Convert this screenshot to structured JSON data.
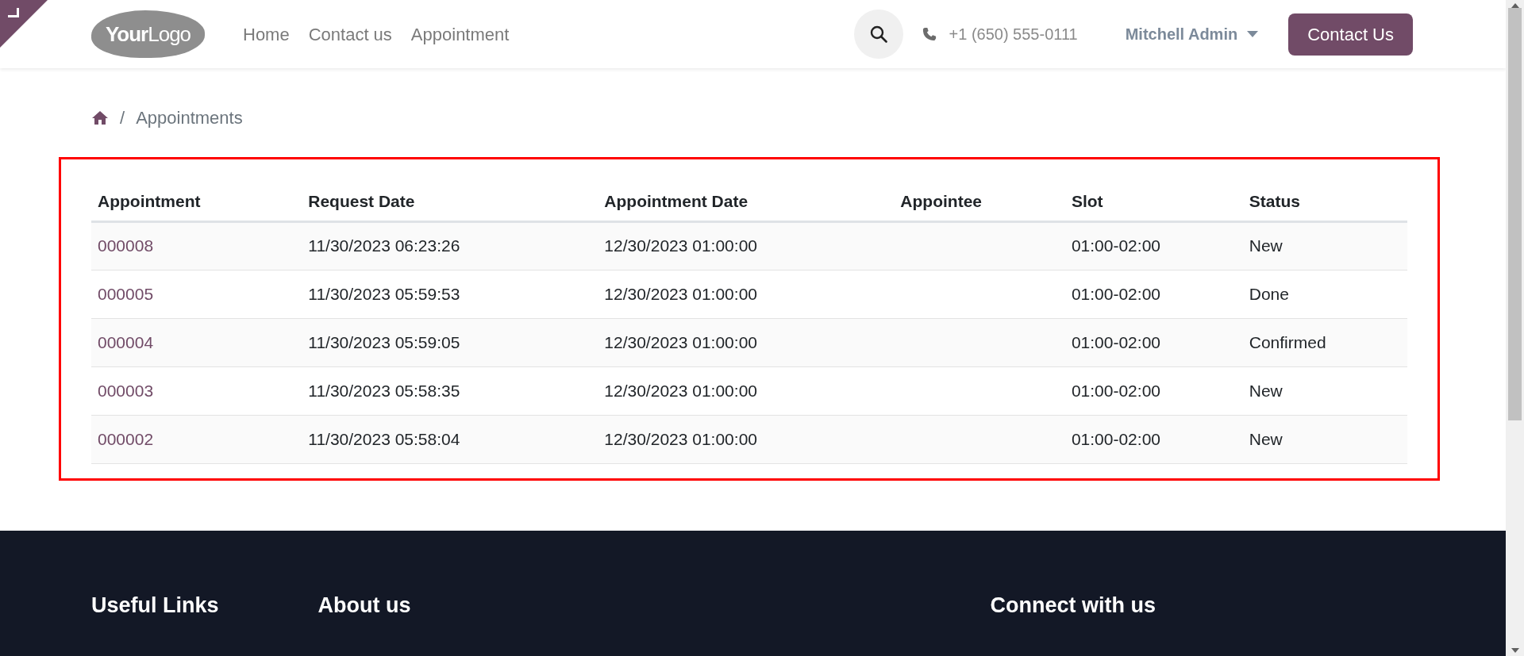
{
  "header": {
    "logo": {
      "bold": "Your",
      "light": "Logo"
    },
    "nav": [
      {
        "label": "Home"
      },
      {
        "label": "Contact us"
      },
      {
        "label": "Appointment"
      }
    ],
    "phone": "+1 (650) 555-0111",
    "user": "Mitchell Admin",
    "cta": "Contact Us"
  },
  "breadcrumb": {
    "separator": "/",
    "current": "Appointments"
  },
  "table": {
    "columns": [
      "Appointment",
      "Request Date",
      "Appointment Date",
      "Appointee",
      "Slot",
      "Status"
    ],
    "rows": [
      [
        "000008",
        "11/30/2023 06:23:26",
        "12/30/2023 01:00:00",
        "",
        "01:00-02:00",
        "New"
      ],
      [
        "000005",
        "11/30/2023 05:59:53",
        "12/30/2023 01:00:00",
        "",
        "01:00-02:00",
        "Done"
      ],
      [
        "000004",
        "11/30/2023 05:59:05",
        "12/30/2023 01:00:00",
        "",
        "01:00-02:00",
        "Confirmed"
      ],
      [
        "000003",
        "11/30/2023 05:58:35",
        "12/30/2023 01:00:00",
        "",
        "01:00-02:00",
        "New"
      ],
      [
        "000002",
        "11/30/2023 05:58:04",
        "12/30/2023 01:00:00",
        "",
        "01:00-02:00",
        "New"
      ]
    ]
  },
  "footer": {
    "headings": [
      "Useful Links",
      "About us",
      "Connect with us"
    ]
  }
}
